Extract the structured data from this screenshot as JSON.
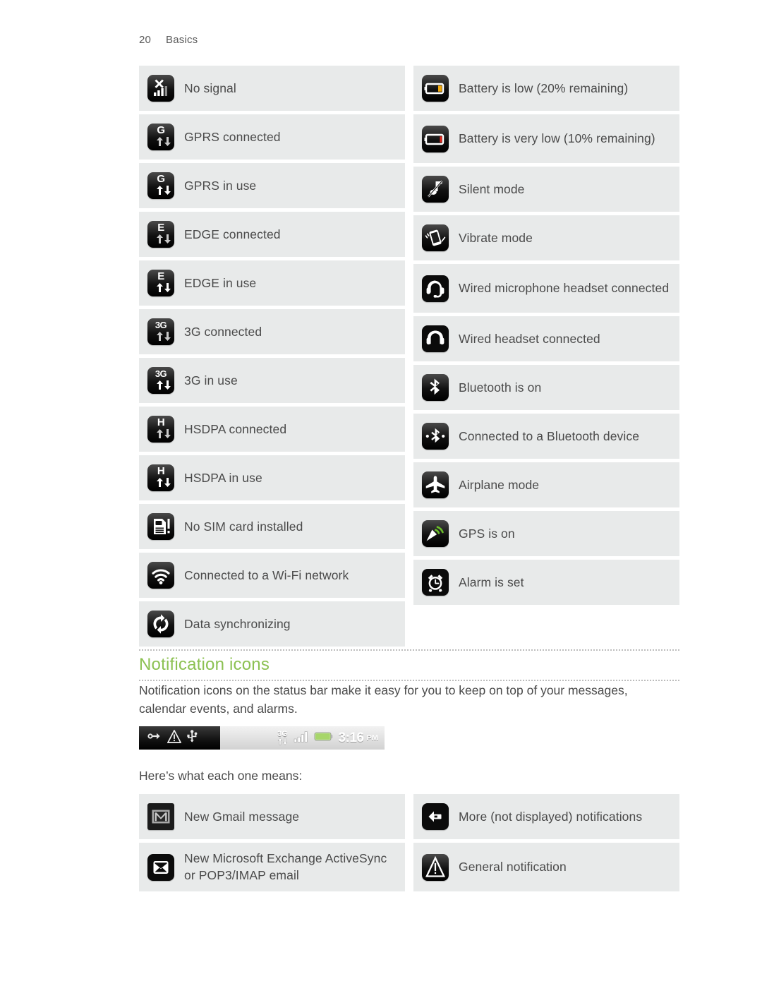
{
  "header": {
    "page_number": "20",
    "chapter": "Basics"
  },
  "status_icons_table": {
    "left_column": [
      {
        "label": "No signal",
        "icon": "no-signal-icon"
      },
      {
        "label": "GPRS connected",
        "icon": "gprs-connected-icon"
      },
      {
        "label": "GPRS in use",
        "icon": "gprs-in-use-icon"
      },
      {
        "label": "EDGE connected",
        "icon": "edge-connected-icon"
      },
      {
        "label": "EDGE in use",
        "icon": "edge-in-use-icon"
      },
      {
        "label": "3G connected",
        "icon": "3g-connected-icon"
      },
      {
        "label": "3G in use",
        "icon": "3g-in-use-icon"
      },
      {
        "label": "HSDPA connected",
        "icon": "hsdpa-connected-icon"
      },
      {
        "label": "HSDPA in use",
        "icon": "hsdpa-in-use-icon"
      },
      {
        "label": "No SIM card installed",
        "icon": "no-sim-card-icon"
      },
      {
        "label": "Connected to a Wi-Fi network",
        "icon": "wifi-icon"
      },
      {
        "label": "Data synchronizing",
        "icon": "sync-icon"
      }
    ],
    "right_column": [
      {
        "label": "Battery is low (20% remaining)",
        "icon": "battery-low-icon"
      },
      {
        "label": "Battery is very low (10% remaining)",
        "icon": "battery-very-low-icon"
      },
      {
        "label": "Silent mode",
        "icon": "silent-mode-icon"
      },
      {
        "label": "Vibrate mode",
        "icon": "vibrate-mode-icon"
      },
      {
        "label": "Wired microphone headset connected",
        "icon": "headset-mic-icon"
      },
      {
        "label": "Wired headset connected",
        "icon": "headphones-icon"
      },
      {
        "label": "Bluetooth is on",
        "icon": "bluetooth-icon"
      },
      {
        "label": "Connected to a Bluetooth device",
        "icon": "bluetooth-connected-icon"
      },
      {
        "label": "Airplane mode",
        "icon": "airplane-icon"
      },
      {
        "label": "GPS is on",
        "icon": "gps-icon"
      },
      {
        "label": "Alarm is set",
        "icon": "alarm-clock-icon"
      }
    ]
  },
  "notification_section": {
    "title": "Notification icons",
    "intro": "Notification icons on the status bar make it easy for you to keep on top of your messages, calendar events, and alarms.",
    "caption": "Here’s what each one means:",
    "status_bar": {
      "left_icons": [
        "call-link-icon",
        "warning-triangle-icon",
        "usb-icon"
      ],
      "network_label": "3G",
      "signal_icon": "signal-bars-icon",
      "battery_icon": "battery-full-icon",
      "time": "3:16",
      "ampm": "PM"
    },
    "left_column": [
      {
        "label": "New Gmail message",
        "icon": "gmail-icon"
      },
      {
        "label": "New Microsoft Exchange ActiveSync or POP3/IMAP email",
        "icon": "email-envelope-icon"
      }
    ],
    "right_column": [
      {
        "label": "More (not displayed) notifications",
        "icon": "more-notifications-icon"
      },
      {
        "label": "General notification",
        "icon": "general-notification-icon"
      }
    ]
  },
  "colors": {
    "accent_green": "#8cc152",
    "row_background": "#e8eaea",
    "text": "#4a4a4a",
    "battery_low": "#f0a80c",
    "battery_critical": "#e8281e",
    "gps_green": "#6bbd2a",
    "battery_full_green": "#9fd24f"
  }
}
